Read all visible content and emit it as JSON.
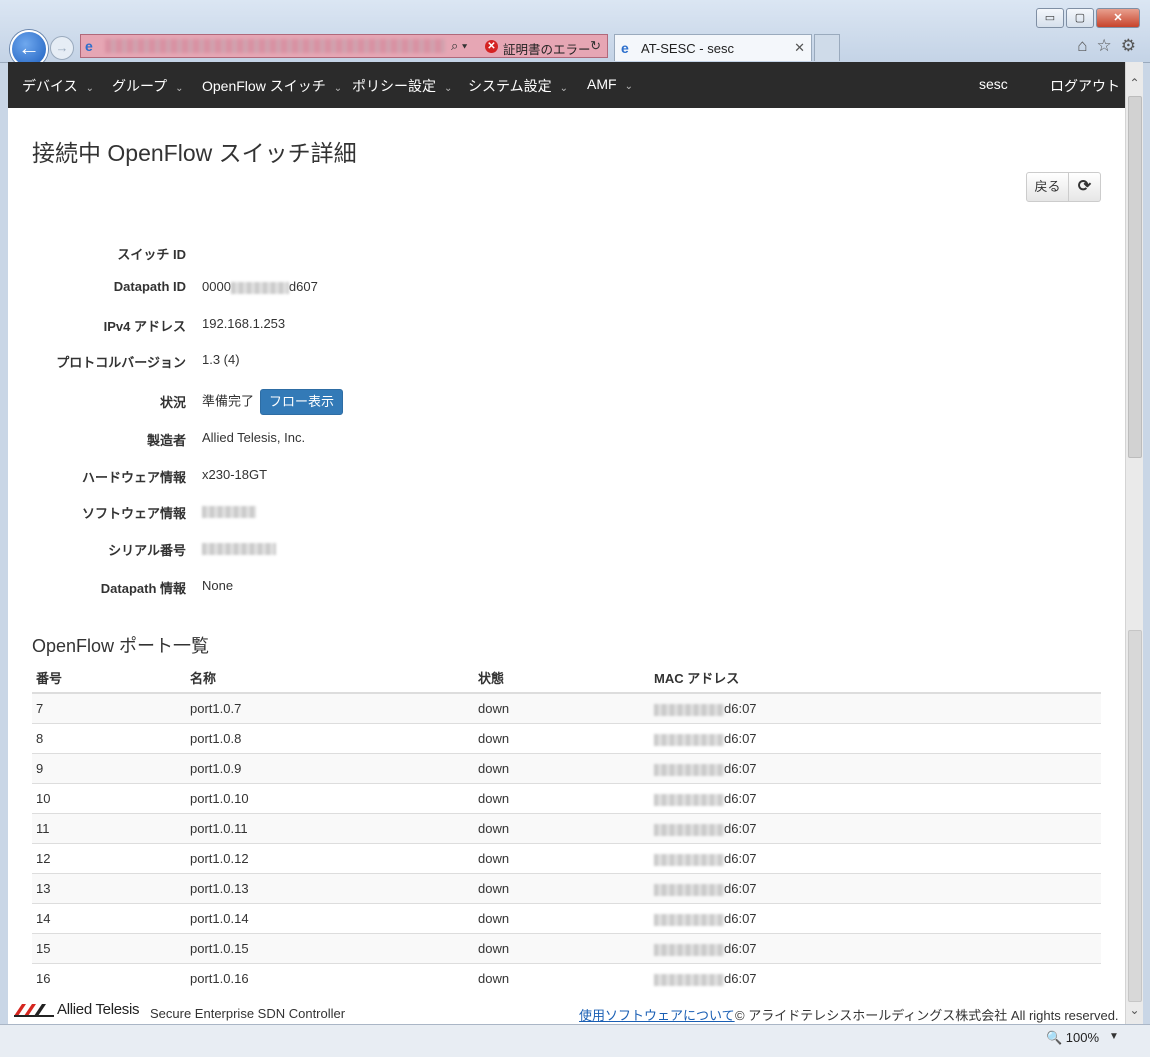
{
  "browser": {
    "window_buttons": {
      "minimize": "▭",
      "maximize": "▢",
      "close": "✕"
    },
    "back_icon": "arrow-left-icon",
    "forward_icon": "arrow-right-icon",
    "address": {
      "cert_error": "証明書のエラー",
      "search_glyph": "⌕ ▾",
      "refresh_glyph": "↻"
    },
    "tab": {
      "title": "AT-SESC - sesc",
      "close": "✕"
    },
    "tools": {
      "home": "⌂",
      "favorites": "☆",
      "settings": "⚙"
    }
  },
  "navbar": {
    "items": [
      {
        "label": "デバイス"
      },
      {
        "label": "グループ"
      },
      {
        "label": "OpenFlow スイッチ"
      },
      {
        "label": "ポリシー設定"
      },
      {
        "label": "システム設定"
      },
      {
        "label": "AMF"
      }
    ],
    "caret": "⌄",
    "user": "sesc",
    "logout": "ログアウト"
  },
  "page": {
    "title": "接続中 OpenFlow スイッチ詳細",
    "back_button": "戻る",
    "refresh_button": "⟳",
    "details": [
      {
        "label": "スイッチ ID",
        "value": ""
      },
      {
        "label": "Datapath ID",
        "value_prefix": "0000",
        "value_suffix": "d607"
      },
      {
        "label": "IPv4 アドレス",
        "value": "192.168.1.253"
      },
      {
        "label": "プロトコルバージョン",
        "value": "1.3 (4)"
      },
      {
        "label": "状況",
        "value": "準備完了",
        "button": "フロー表示"
      },
      {
        "label": "製造者",
        "value": "Allied Telesis, Inc."
      },
      {
        "label": "ハードウェア情報",
        "value": "x230-18GT"
      },
      {
        "label": "ソフトウェア情報",
        "value": ""
      },
      {
        "label": "シリアル番号",
        "value": ""
      },
      {
        "label": "Datapath 情報",
        "value": "None"
      }
    ],
    "ports_title": "OpenFlow ポート一覧",
    "ports_columns": [
      "番号",
      "名称",
      "状態",
      "MAC アドレス"
    ],
    "ports": [
      {
        "num": "7",
        "name": "port1.0.7",
        "state": "down",
        "mac_suffix": "d6:07"
      },
      {
        "num": "8",
        "name": "port1.0.8",
        "state": "down",
        "mac_suffix": "d6:07"
      },
      {
        "num": "9",
        "name": "port1.0.9",
        "state": "down",
        "mac_suffix": "d6:07"
      },
      {
        "num": "10",
        "name": "port1.0.10",
        "state": "down",
        "mac_suffix": "d6:07"
      },
      {
        "num": "11",
        "name": "port1.0.11",
        "state": "down",
        "mac_suffix": "d6:07"
      },
      {
        "num": "12",
        "name": "port1.0.12",
        "state": "down",
        "mac_suffix": "d6:07"
      },
      {
        "num": "13",
        "name": "port1.0.13",
        "state": "down",
        "mac_suffix": "d6:07"
      },
      {
        "num": "14",
        "name": "port1.0.14",
        "state": "down",
        "mac_suffix": "d6:07"
      },
      {
        "num": "15",
        "name": "port1.0.15",
        "state": "down",
        "mac_suffix": "d6:07"
      },
      {
        "num": "16",
        "name": "port1.0.16",
        "state": "down",
        "mac_suffix": "d6:07"
      }
    ]
  },
  "footer": {
    "logo_text": "Allied Telesis",
    "product": "Secure Enterprise SDN Controller",
    "link": "使用ソフトウェアについて",
    "copyright": "© アライドテレシスホールディングス株式会社 All rights reserved."
  },
  "statusbar": {
    "zoom": "🔍 100%",
    "zoom_caret": "▼"
  },
  "colors": {
    "navbar": "#2b2b2b",
    "primary_button": "#337ab7",
    "link": "#1a5fb4",
    "address_error": "#e6a6b4"
  }
}
